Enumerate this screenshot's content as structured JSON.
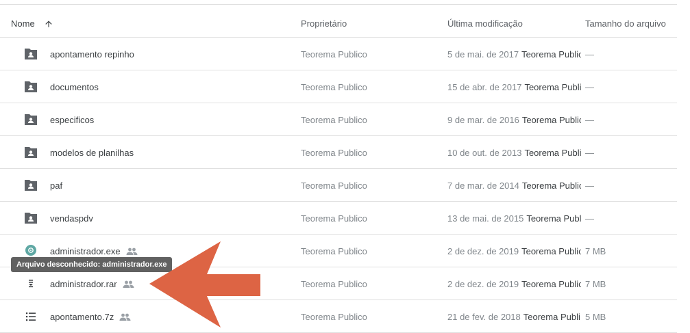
{
  "header": {
    "name": "Nome",
    "owner": "Proprietário",
    "modified": "Última modificação",
    "size": "Tamanho do arquivo"
  },
  "rows": [
    {
      "name": "apontamento repinho",
      "type": "folder",
      "owner": "Teorema Publico",
      "date": "5 de mai. de 2017",
      "modified_by": "Teorema Public",
      "size": "—"
    },
    {
      "name": "documentos",
      "type": "folder",
      "owner": "Teorema Publico",
      "date": "15 de abr. de 2017",
      "modified_by": "Teorema Publi",
      "size": "—"
    },
    {
      "name": "especificos",
      "type": "folder",
      "owner": "Teorema Publico",
      "date": "9 de mar. de 2016",
      "modified_by": "Teorema Public",
      "size": "—"
    },
    {
      "name": "modelos de planilhas",
      "type": "folder",
      "owner": "Teorema Publico",
      "date": "10 de out. de 2013",
      "modified_by": "Teorema Publi",
      "size": "—"
    },
    {
      "name": "paf",
      "type": "folder",
      "owner": "Teorema Publico",
      "date": "7 de mar. de 2014",
      "modified_by": "Teorema Public",
      "size": "—"
    },
    {
      "name": "vendaspdv",
      "type": "folder",
      "owner": "Teorema Publico",
      "date": "13 de mai. de 2015",
      "modified_by": "Teorema Publ",
      "size": "—"
    },
    {
      "name": "administrador.exe",
      "type": "exe",
      "owner": "Teorema Publico",
      "date": "2 de dez. de 2019",
      "modified_by": "Teorema Public",
      "size": "7 MB"
    },
    {
      "name": "administrador.rar",
      "type": "archive",
      "owner": "Teorema Publico",
      "date": "2 de dez. de 2019",
      "modified_by": "Teorema Public",
      "size": "7 MB"
    },
    {
      "name": "apontamento.7z",
      "type": "list",
      "owner": "Teorema Publico",
      "date": "21 de fev. de 2018",
      "modified_by": "Teorema Publi",
      "size": "5 MB"
    }
  ],
  "tooltip": "Arquivo desconhecido: administrador.exe",
  "colors": {
    "folder_icon": "#5f6368",
    "exe_icon": "#5fa8a4",
    "arrow": "#dd6444"
  },
  "icons": {
    "folder": "shared-folder-icon",
    "exe": "unknown-file-icon",
    "archive": "archive-icon",
    "list": "list-file-icon",
    "shared": "people-icon",
    "sort": "arrow-up-icon"
  }
}
